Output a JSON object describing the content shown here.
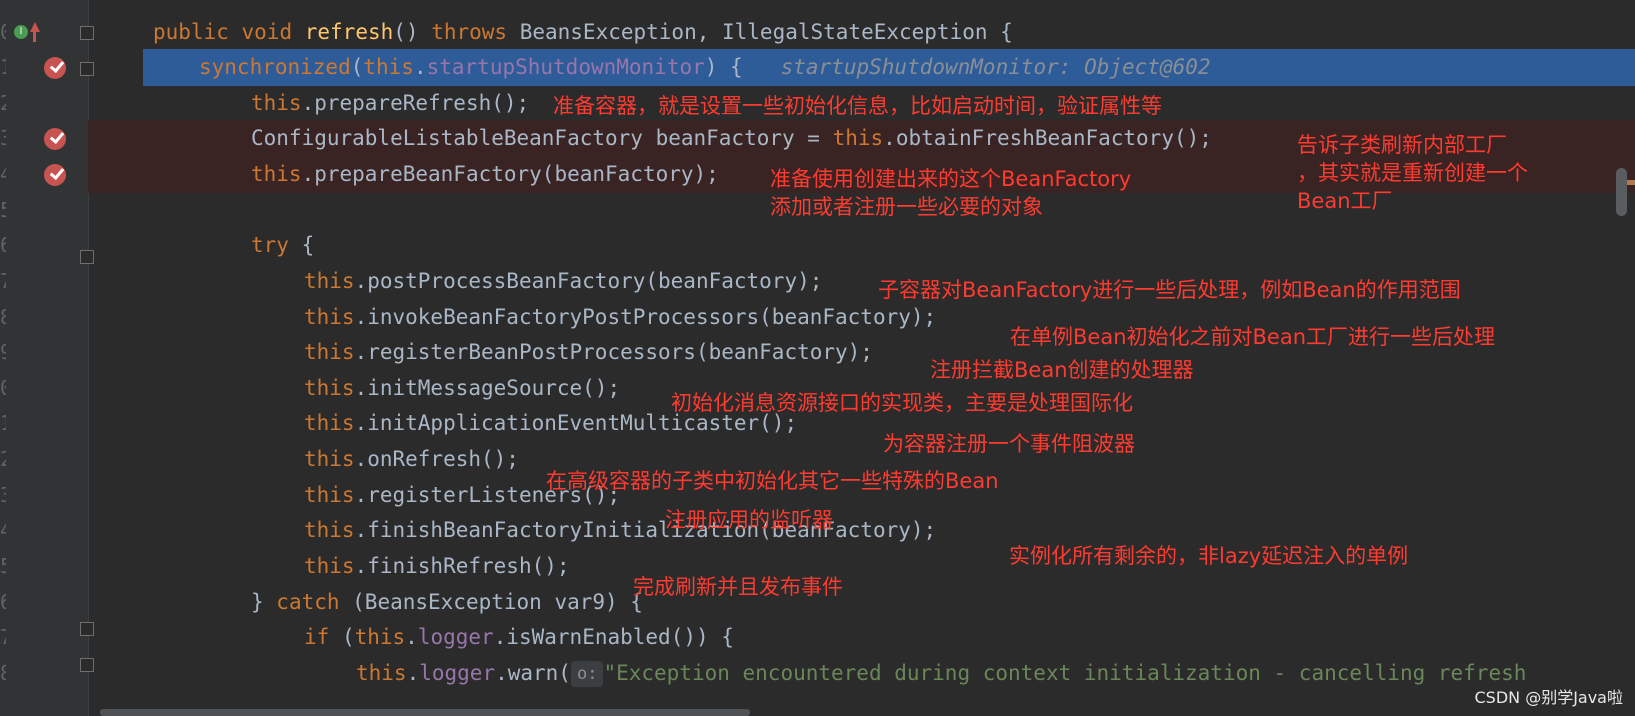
{
  "gutter": {
    "line_digits": [
      "0",
      "1",
      "2",
      "3",
      "4",
      "5",
      "6",
      "7",
      "8",
      "9",
      "0",
      "1",
      "2",
      "3",
      "4",
      "5",
      "6",
      "7",
      "8"
    ]
  },
  "code": {
    "l1": {
      "kw1": "public",
      "kw2": "void",
      "fn": "refresh",
      "p1": "() ",
      "kw3": "throws",
      "rest": " BeansException, IllegalStateException {"
    },
    "l2": {
      "kw1": "synchronized",
      "p1": "(",
      "kw2": "this",
      ".": ".",
      "fld": "startupShutdownMonitor",
      "p2": ") {",
      "hint": "startupShutdownMonitor: Object@602"
    },
    "l3": {
      "kw": "this",
      "rest": ".prepareRefresh();"
    },
    "l4": {
      "a": "ConfigurableListableBeanFactory beanFactory = ",
      "kw": "this",
      "b": ".obtainFreshBeanFactory();"
    },
    "l5": {
      "kw": "this",
      "rest": ".prepareBeanFactory(beanFactory);"
    },
    "l7": {
      "kw": "try",
      "rest": " {"
    },
    "l8": {
      "kw": "this",
      "rest": ".postProcessBeanFactory(beanFactory);"
    },
    "l9": {
      "kw": "this",
      "rest": ".invokeBeanFactoryPostProcessors(beanFactory);"
    },
    "l10": {
      "kw": "this",
      "rest": ".registerBeanPostProcessors(beanFactory);"
    },
    "l11": {
      "kw": "this",
      "rest": ".initMessageSource();"
    },
    "l12": {
      "kw": "this",
      "rest": ".initApplicationEventMulticaster();"
    },
    "l13": {
      "kw": "this",
      "rest": ".onRefresh();"
    },
    "l14": {
      "kw": "this",
      "rest": ".registerListeners();"
    },
    "l15": {
      "kw": "this",
      "rest": ".finishBeanFactoryInitialization(beanFactory);"
    },
    "l16": {
      "kw": "this",
      "rest": ".finishRefresh();"
    },
    "l17": {
      "a": "} ",
      "kw": "catch",
      "b": " (BeansException var9) {"
    },
    "l18": {
      "kw1": "if",
      "a": " (",
      "kw2": "this",
      ".": ".",
      "fld": "logger",
      "b": ".isWarnEnabled()) {"
    },
    "l19": {
      "kw": "this",
      ".": ".",
      "fld": "logger",
      "a": ".warn(",
      "chip": "o:",
      "str": "\"Exception encountered during context initialization - cancelling refresh"
    }
  },
  "annotations": {
    "a1": "准备容器，就是设置一些初始化信息，比如启动时间，验证属性等",
    "a2": "告诉子类刷新内部工厂\n，其实就是重新创建一个\nBean工厂",
    "a3": "准备使用创建出来的这个BeanFactory\n添加或者注册一些必要的对象",
    "a4": "子容器对BeanFactory进行一些后处理，例如Bean的作用范围",
    "a5": "在单例Bean初始化之前对Bean工厂进行一些后处理",
    "a6": "注册拦截Bean创建的处理器",
    "a7": "初始化消息资源接口的实现类，主要是处理国际化",
    "a8": "为容器注册一个事件阻波器",
    "a9": "在高级容器的子类中初始化其它一些特殊的Bean",
    "a10": "注册应用的监听器",
    "a11": "实例化所有剩余的，非lazy延迟注入的单例",
    "a12": "完成刷新并且发布事件"
  },
  "overlay_marks": {
    "override": "I"
  },
  "watermark": "CSDN @别学Java啦",
  "colors": {
    "background": "#2b2b2b",
    "execution_line": "#2d5c99",
    "breakpoint": "#c75450",
    "keyword": "#cc7832",
    "method": "#ffc66d",
    "field": "#9876aa",
    "string": "#6a8759",
    "annotation": "#ff3b30"
  }
}
